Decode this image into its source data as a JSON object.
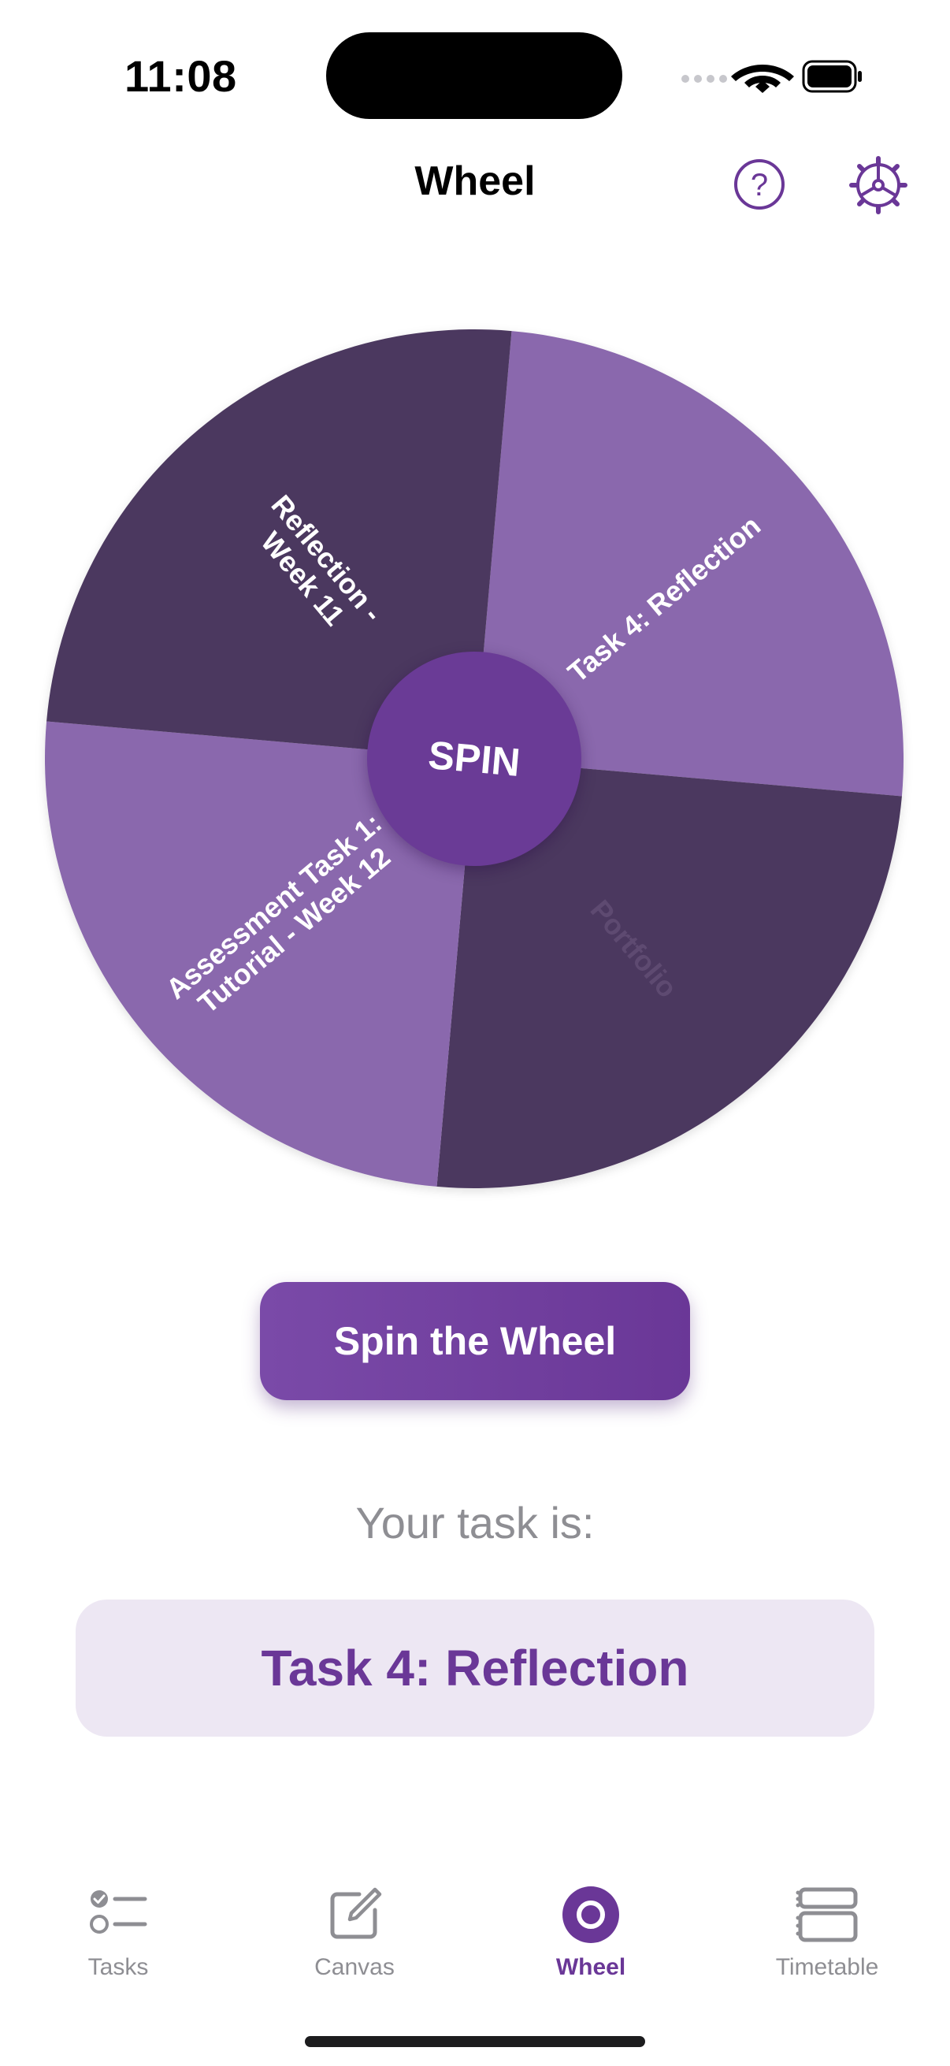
{
  "status_bar": {
    "time": "11:08"
  },
  "header": {
    "title": "Wheel",
    "help_icon": "question-circle-icon",
    "settings_icon": "gear-icon"
  },
  "wheel": {
    "center_label": "SPIN",
    "segments": [
      {
        "label": "Task 4: Reflection",
        "lines": [
          "Task 4: Reflection"
        ],
        "color": "#8a67ad",
        "text_color": "#ffffff"
      },
      {
        "label": "Portfolio",
        "lines": [
          "Portfolio"
        ],
        "color": "#4c385f",
        "text_color": "#5e4a71"
      },
      {
        "label": "Assessment Task 1: Tutorial - Week 12",
        "lines": [
          "Assessment Task 1:",
          "Tutorial - Week 12"
        ],
        "color": "#8a67ad",
        "text_color": "#ffffff"
      },
      {
        "label": "Reflection - Week 11",
        "lines": [
          "Reflection -",
          "Week 11"
        ],
        "color": "#4c385f",
        "text_color": "#ffffff"
      }
    ]
  },
  "spin_button": {
    "label": "Spin the Wheel"
  },
  "result": {
    "label": "Your task is:",
    "value": "Task 4: Reflection"
  },
  "tabbar": {
    "tabs": [
      {
        "label": "Tasks",
        "icon": "checklist-icon",
        "active": false
      },
      {
        "label": "Canvas",
        "icon": "edit-square-icon",
        "active": false
      },
      {
        "label": "Wheel",
        "icon": "wheel-icon",
        "active": true
      },
      {
        "label": "Timetable",
        "icon": "timetable-icon",
        "active": false
      }
    ]
  },
  "colors": {
    "accent": "#6a3797",
    "segment_light": "#8a67ad",
    "segment_dark": "#4c385f",
    "result_background": "#ede7f3",
    "inactive_tab": "#8e8e93"
  }
}
